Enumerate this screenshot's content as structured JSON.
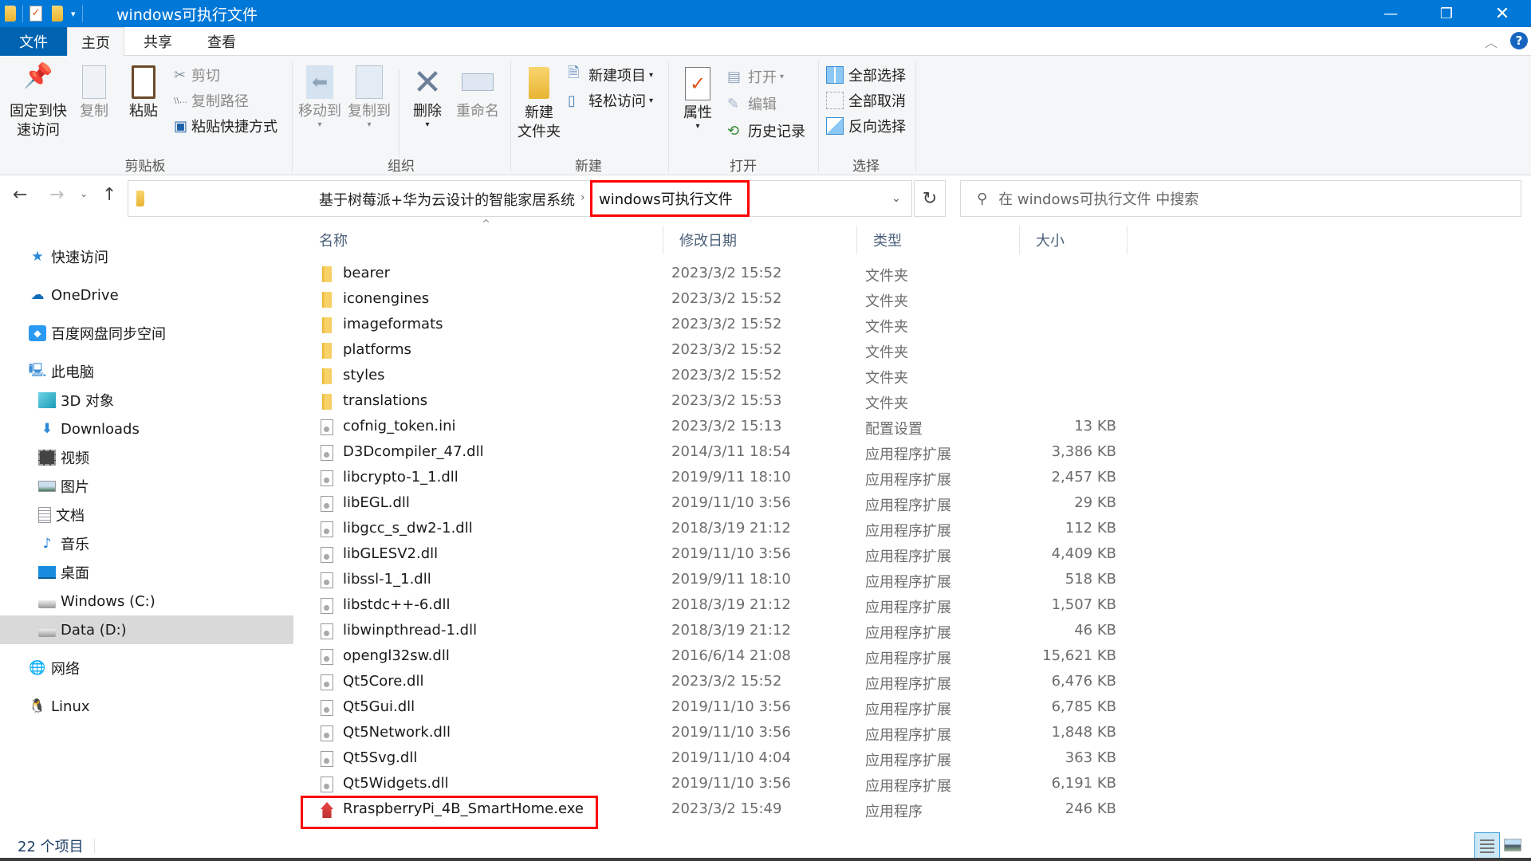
{
  "window": {
    "title": "windows可执行文件",
    "minimize_icon": "minimize-icon",
    "maximize_icon": "restore-icon",
    "close_icon": "close-icon"
  },
  "tabs": [
    {
      "label": "文件",
      "active": false
    },
    {
      "label": "主页",
      "active": true
    },
    {
      "label": "共享",
      "active": false
    },
    {
      "label": "查看",
      "active": false
    }
  ],
  "ribbon": {
    "groups": {
      "clipboard": "剪贴板",
      "organize": "组织",
      "new": "新建",
      "open": "打开",
      "select": "选择"
    },
    "pin_quick_access_line1": "固定到快",
    "pin_quick_access_line2": "速访问",
    "copy": "复制",
    "paste": "粘贴",
    "cut": "剪切",
    "copy_path": "复制路径",
    "paste_shortcut": "粘贴快捷方式",
    "move_to": "移动到",
    "copy_to": "复制到",
    "delete": "删除",
    "rename": "重命名",
    "new_folder_line1": "新建",
    "new_folder_line2": "文件夹",
    "new_item": "新建项目",
    "easy_access": "轻松访问",
    "properties": "属性",
    "open": "打开",
    "edit": "编辑",
    "history": "历史记录",
    "select_all": "全部选择",
    "select_none": "全部取消",
    "invert_selection": "反向选择"
  },
  "address": {
    "breadcrumbs": [
      "基于树莓派+华为云设计的智能家居系统",
      "windows可执行文件"
    ],
    "search_placeholder": "在 windows可执行文件 中搜索"
  },
  "sidebar": {
    "items": [
      {
        "label": "快速访问",
        "icon": "star-icon"
      },
      {
        "label": "OneDrive",
        "icon": "cloud-icon"
      },
      {
        "label": "百度网盘同步空间",
        "icon": "baidu-netdisk-icon"
      },
      {
        "label": "此电脑",
        "icon": "computer-icon"
      },
      {
        "label": "3D 对象",
        "icon": "cube-icon"
      },
      {
        "label": "Downloads",
        "icon": "download-icon"
      },
      {
        "label": "视频",
        "icon": "video-icon"
      },
      {
        "label": "图片",
        "icon": "picture-icon"
      },
      {
        "label": "文档",
        "icon": "document-icon"
      },
      {
        "label": "音乐",
        "icon": "music-icon"
      },
      {
        "label": "桌面",
        "icon": "desktop-icon"
      },
      {
        "label": "Windows (C:)",
        "icon": "drive-icon"
      },
      {
        "label": "Data (D:)",
        "icon": "drive-icon",
        "selected": true
      },
      {
        "label": "网络",
        "icon": "network-icon"
      },
      {
        "label": "Linux",
        "icon": "linux-icon"
      }
    ]
  },
  "columns": [
    "名称",
    "修改日期",
    "类型",
    "大小"
  ],
  "files": [
    {
      "name": "bearer",
      "date": "2023/3/2 15:52",
      "type": "文件夹",
      "size": "",
      "kind": "folder"
    },
    {
      "name": "iconengines",
      "date": "2023/3/2 15:52",
      "type": "文件夹",
      "size": "",
      "kind": "folder"
    },
    {
      "name": "imageformats",
      "date": "2023/3/2 15:52",
      "type": "文件夹",
      "size": "",
      "kind": "folder"
    },
    {
      "name": "platforms",
      "date": "2023/3/2 15:52",
      "type": "文件夹",
      "size": "",
      "kind": "folder"
    },
    {
      "name": "styles",
      "date": "2023/3/2 15:52",
      "type": "文件夹",
      "size": "",
      "kind": "folder"
    },
    {
      "name": "translations",
      "date": "2023/3/2 15:53",
      "type": "文件夹",
      "size": "",
      "kind": "folder"
    },
    {
      "name": "cofnig_token.ini",
      "date": "2023/3/2 15:13",
      "type": "配置设置",
      "size": "13 KB",
      "kind": "ini"
    },
    {
      "name": "D3Dcompiler_47.dll",
      "date": "2014/3/11 18:54",
      "type": "应用程序扩展",
      "size": "3,386 KB",
      "kind": "dll"
    },
    {
      "name": "libcrypto-1_1.dll",
      "date": "2019/9/11 18:10",
      "type": "应用程序扩展",
      "size": "2,457 KB",
      "kind": "dll"
    },
    {
      "name": "libEGL.dll",
      "date": "2019/11/10 3:56",
      "type": "应用程序扩展",
      "size": "29 KB",
      "kind": "dll"
    },
    {
      "name": "libgcc_s_dw2-1.dll",
      "date": "2018/3/19 21:12",
      "type": "应用程序扩展",
      "size": "112 KB",
      "kind": "dll"
    },
    {
      "name": "libGLESV2.dll",
      "date": "2019/11/10 3:56",
      "type": "应用程序扩展",
      "size": "4,409 KB",
      "kind": "dll"
    },
    {
      "name": "libssl-1_1.dll",
      "date": "2019/9/11 18:10",
      "type": "应用程序扩展",
      "size": "518 KB",
      "kind": "dll"
    },
    {
      "name": "libstdc++-6.dll",
      "date": "2018/3/19 21:12",
      "type": "应用程序扩展",
      "size": "1,507 KB",
      "kind": "dll"
    },
    {
      "name": "libwinpthread-1.dll",
      "date": "2018/3/19 21:12",
      "type": "应用程序扩展",
      "size": "46 KB",
      "kind": "dll"
    },
    {
      "name": "opengl32sw.dll",
      "date": "2016/6/14 21:08",
      "type": "应用程序扩展",
      "size": "15,621 KB",
      "kind": "dll"
    },
    {
      "name": "Qt5Core.dll",
      "date": "2023/3/2 15:52",
      "type": "应用程序扩展",
      "size": "6,476 KB",
      "kind": "dll"
    },
    {
      "name": "Qt5Gui.dll",
      "date": "2019/11/10 3:56",
      "type": "应用程序扩展",
      "size": "6,785 KB",
      "kind": "dll"
    },
    {
      "name": "Qt5Network.dll",
      "date": "2019/11/10 3:56",
      "type": "应用程序扩展",
      "size": "1,848 KB",
      "kind": "dll"
    },
    {
      "name": "Qt5Svg.dll",
      "date": "2019/11/10 4:04",
      "type": "应用程序扩展",
      "size": "363 KB",
      "kind": "dll"
    },
    {
      "name": "Qt5Widgets.dll",
      "date": "2019/11/10 3:56",
      "type": "应用程序扩展",
      "size": "6,191 KB",
      "kind": "dll"
    },
    {
      "name": "RraspberryPi_4B_SmartHome.exe",
      "date": "2023/3/2 15:49",
      "type": "应用程序",
      "size": "246 KB",
      "kind": "exe"
    }
  ],
  "status": {
    "item_count": "22 个项目"
  },
  "colors": {
    "titlebar": "#0078d7",
    "highlight_box": "#ff0000",
    "selected_nav": "#d9d9d9"
  }
}
